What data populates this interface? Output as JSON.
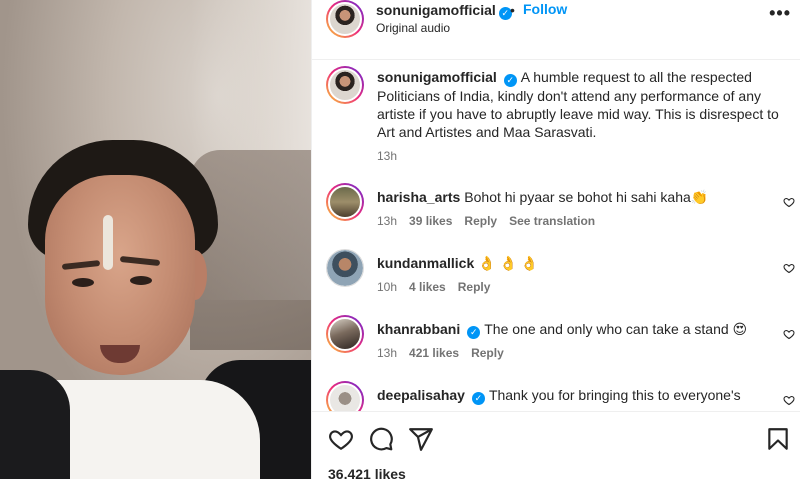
{
  "post": {
    "username": "sonunigamofficial",
    "follow_label": "Follow",
    "dot": "•",
    "audio": "Original audio",
    "more_label": "•••"
  },
  "caption": {
    "username": "sonunigamofficial",
    "text": "A humble request to all the respected Politicians of India, kindly don't attend any performance of any artiste if you have to abruptly leave mid way. This is disrespect to Art and Artistes and Maa Sarasvati.",
    "time": "13h"
  },
  "comments": [
    {
      "username": "harisha_arts",
      "text": "Bohot hi pyaar se bohot hi sahi kaha👏",
      "time": "13h",
      "likes": "39 likes",
      "reply": "Reply",
      "translate": "See translation"
    },
    {
      "username": "kundanmallick",
      "text": "👌 👌 👌",
      "time": "10h",
      "likes": "4 likes",
      "reply": "Reply"
    },
    {
      "username": "khanrabbani",
      "text": "The one and only who can take a stand 😍",
      "time": "13h",
      "likes": "421 likes",
      "reply": "Reply"
    },
    {
      "username": "deepalisahay",
      "text": "Thank you for bringing this to everyone's"
    }
  ],
  "footer": {
    "likes": "36,421 likes"
  },
  "colors": {
    "accent": "#0095f6",
    "text": "#262626",
    "muted": "#737373",
    "border": "#efefef"
  },
  "icons": [
    "heart-icon",
    "comment-icon",
    "share-icon",
    "bookmark-icon",
    "verified-badge-icon",
    "more-options-icon"
  ]
}
